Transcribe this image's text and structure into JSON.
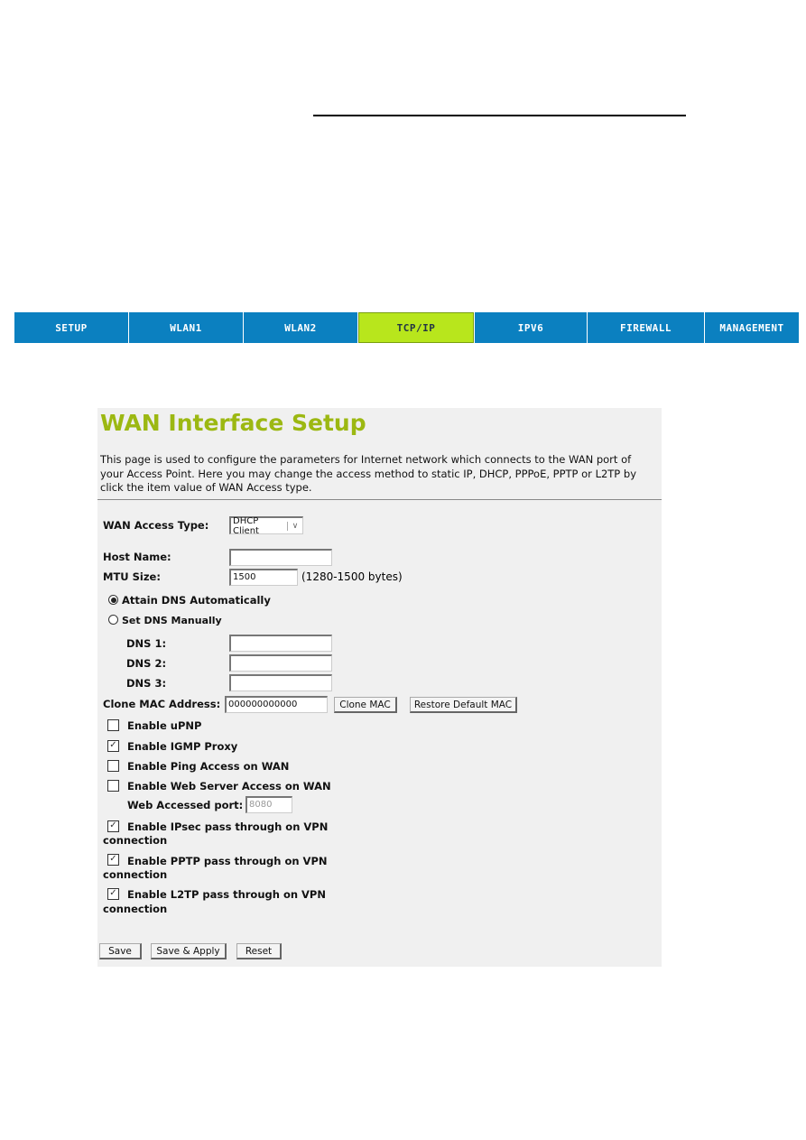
{
  "nav": {
    "tabs": [
      {
        "label": "SETUP"
      },
      {
        "label": "WLAN1"
      },
      {
        "label": "WLAN2"
      },
      {
        "label": "TCP/IP",
        "active": true
      },
      {
        "label": "IPV6"
      },
      {
        "label": "FIREWALL"
      },
      {
        "label": "MANAGEMENT"
      }
    ],
    "color": "#0b80c0",
    "active_color": "#b8e61c"
  },
  "page": {
    "title": "WAN Interface Setup",
    "title_color": "#9cb812",
    "description": "This page is used to configure the parameters for Internet network which connects to the WAN port of your Access Point. Here you may change the access method to static IP, DHCP, PPPoE, PPTP or L2TP by click the item value of WAN Access type."
  },
  "form": {
    "wan_access_type": {
      "label": "WAN Access Type:",
      "value": "DHCP Client"
    },
    "host_name": {
      "label": "Host Name:",
      "value": ""
    },
    "mtu": {
      "label": "MTU Size:",
      "value": "1500",
      "hint": "(1280-1500 bytes)"
    },
    "dns_auto": {
      "label": "Attain DNS Automatically",
      "selected": true
    },
    "dns_manual": {
      "label": "Set DNS Manually",
      "selected": false
    },
    "dns1": {
      "label": "DNS 1:",
      "value": ""
    },
    "dns2": {
      "label": "DNS 2:",
      "value": ""
    },
    "dns3": {
      "label": "DNS 3:",
      "value": ""
    },
    "clone_mac": {
      "label": "Clone MAC Address:",
      "value": "000000000000",
      "clone_button": "Clone MAC",
      "restore_button": "Restore Default MAC"
    },
    "checkboxes": [
      {
        "label": "Enable uPNP",
        "checked": false
      },
      {
        "label": "Enable IGMP Proxy",
        "checked": true
      },
      {
        "label": "Enable Ping Access on WAN",
        "checked": false
      },
      {
        "label": "Enable Web Server Access on WAN",
        "checked": false
      }
    ],
    "web_port": {
      "label": "Web Accessed port:",
      "value": "8080"
    },
    "vpn": [
      {
        "label": "Enable IPsec pass through on VPN",
        "label2": "connection",
        "checked": true
      },
      {
        "label": "Enable PPTP pass through on VPN",
        "label2": "connection",
        "checked": true
      },
      {
        "label": "Enable L2TP pass through on VPN",
        "label2": "connection",
        "checked": true
      }
    ],
    "buttons": {
      "save": "Save",
      "save_apply": "Save & Apply",
      "reset": "Reset"
    }
  }
}
